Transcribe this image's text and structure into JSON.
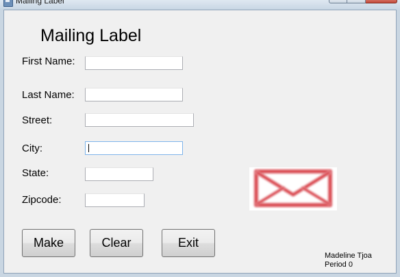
{
  "window": {
    "title": "Mailing Label",
    "icon": "app-form-icon",
    "caption_buttons": [
      "minimize-icon",
      "maximize-icon",
      "close-icon"
    ]
  },
  "form": {
    "heading": "Mailing Label",
    "fields": {
      "first_name": {
        "label": "First Name:",
        "value": ""
      },
      "last_name": {
        "label": "Last Name:",
        "value": ""
      },
      "street": {
        "label": "Street:",
        "value": ""
      },
      "city": {
        "label": "City:",
        "value": ""
      },
      "state": {
        "label": "State:",
        "value": ""
      },
      "zipcode": {
        "label": "Zipcode:",
        "value": ""
      }
    },
    "focused_field": "city"
  },
  "buttons": {
    "make": "Make",
    "clear": "Clear",
    "exit": "Exit"
  },
  "image": {
    "icon": "envelope-icon",
    "color": "#d9323b"
  },
  "credit": {
    "name": "Madeline Tjoa",
    "period": "Period 0"
  }
}
